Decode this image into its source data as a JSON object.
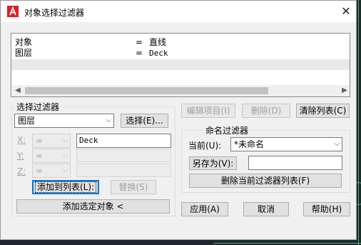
{
  "window": {
    "title": "对象选择过滤器"
  },
  "filter_list": {
    "rows": [
      {
        "property": "对象",
        "operator": "=",
        "value": "直线"
      },
      {
        "property": "图层",
        "operator": "=",
        "value": "Deck"
      }
    ]
  },
  "select_filter": {
    "legend": "选择过滤器",
    "type_value": "图层",
    "select_button": "选择(E)...",
    "x_label": "X:",
    "y_label": "Y:",
    "z_label": "Z:",
    "x_operator": "=",
    "y_operator": "=",
    "z_operator": "=",
    "x_value": "Deck",
    "y_value": "",
    "z_value": "",
    "add_to_list_button": "添加到列表(L):",
    "replace_button": "替换(S)",
    "add_selected_button": "添加选定对象 <"
  },
  "list_actions": {
    "edit_item_button": "编辑项目(I)",
    "delete_button": "删除(D)",
    "clear_list_button": "清除列表(C)"
  },
  "named_filters": {
    "legend": "命名过滤器",
    "current_label": "当前(U):",
    "current_value": "*未命名",
    "save_as_button": "另存为(V):",
    "save_as_value": "",
    "delete_current_button": "删除当前过滤器列表(F)"
  },
  "footer": {
    "apply_button": "应用(A)",
    "cancel_button": "取消",
    "help_button": "帮助(H)"
  },
  "colors": {
    "accent": "#0078d7",
    "app_icon": "#e01e24",
    "background_lines": "#2fc36a"
  }
}
